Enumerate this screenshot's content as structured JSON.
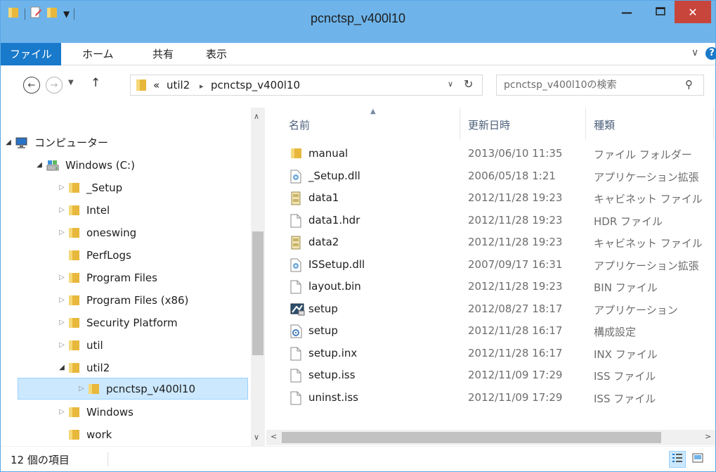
{
  "window": {
    "title": "pcnctsp_v400l10",
    "minimize_glyph": "—",
    "close_glyph": "✕"
  },
  "ribbon": {
    "tabs": [
      {
        "label": "ファイル"
      },
      {
        "label": "ホーム"
      },
      {
        "label": "共有"
      },
      {
        "label": "表示"
      }
    ],
    "expand_glyph": "∨",
    "help_glyph": "?"
  },
  "address": {
    "overflow": "«",
    "crumbs": [
      "util2",
      "pcnctsp_v400l10"
    ],
    "crumb_separator": "▸"
  },
  "search": {
    "placeholder": "pcnctsp_v400l10の検索"
  },
  "tree": [
    {
      "label": "コンピューター",
      "icon": "computer-icon",
      "expanded": true,
      "arrow": "◢"
    },
    {
      "label": "Windows (C:)",
      "icon": "drive-icon",
      "expanded": true,
      "arrow": "◢"
    },
    {
      "label": "_Setup",
      "icon": "folder-icon",
      "arrow": "▷"
    },
    {
      "label": "Intel",
      "icon": "folder-icon",
      "arrow": "▷"
    },
    {
      "label": "oneswing",
      "icon": "folder-icon",
      "arrow": "▷"
    },
    {
      "label": "PerfLogs",
      "icon": "folder-icon",
      "arrow": ""
    },
    {
      "label": "Program Files",
      "icon": "folder-icon",
      "arrow": "▷"
    },
    {
      "label": "Program Files (x86)",
      "icon": "folder-icon",
      "arrow": "▷"
    },
    {
      "label": "Security Platform",
      "icon": "folder-icon",
      "arrow": "▷"
    },
    {
      "label": "util",
      "icon": "folder-icon",
      "arrow": "▷"
    },
    {
      "label": "util2",
      "icon": "folder-icon",
      "expanded": true,
      "arrow": "◢"
    },
    {
      "label": "pcnctsp_v400l10",
      "icon": "folder-icon",
      "selected": true,
      "arrow": "▷"
    },
    {
      "label": "Windows",
      "icon": "folder-icon",
      "arrow": "▷"
    },
    {
      "label": "work",
      "icon": "folder-icon",
      "arrow": ""
    }
  ],
  "columns": {
    "name": "名前",
    "date": "更新日時",
    "type": "種類"
  },
  "files": [
    {
      "name": "manual",
      "date": "2013/06/10 11:35",
      "type": "ファイル フォルダー",
      "icon": "folder-icon"
    },
    {
      "name": "_Setup.dll",
      "date": "2006/05/18 1:21",
      "type": "アプリケーション拡張",
      "icon": "dll-icon"
    },
    {
      "name": "data1",
      "date": "2012/11/28 19:23",
      "type": "キャビネット ファイル",
      "icon": "cabinet-icon"
    },
    {
      "name": "data1.hdr",
      "date": "2012/11/28 19:23",
      "type": "HDR ファイル",
      "icon": "file-icon"
    },
    {
      "name": "data2",
      "date": "2012/11/28 19:23",
      "type": "キャビネット ファイル",
      "icon": "cabinet-icon"
    },
    {
      "name": "ISSetup.dll",
      "date": "2007/09/17 16:31",
      "type": "アプリケーション拡張",
      "icon": "dll-icon"
    },
    {
      "name": "layout.bin",
      "date": "2012/11/28 19:23",
      "type": "BIN ファイル",
      "icon": "file-icon"
    },
    {
      "name": "setup",
      "date": "2012/08/27 18:17",
      "type": "アプリケーション",
      "icon": "setup-exe-icon"
    },
    {
      "name": "setup",
      "date": "2012/11/28 16:17",
      "type": "構成設定",
      "icon": "config-icon"
    },
    {
      "name": "setup.inx",
      "date": "2012/11/28 16:17",
      "type": "INX ファイル",
      "icon": "file-icon"
    },
    {
      "name": "setup.iss",
      "date": "2012/11/09 17:29",
      "type": "ISS ファイル",
      "icon": "file-icon"
    },
    {
      "name": "uninst.iss",
      "date": "2012/11/09 17:29",
      "type": "ISS ファイル",
      "icon": "file-icon"
    }
  ],
  "status": {
    "item_count": "12 個の項目"
  },
  "colors": {
    "titlebar": "#6eb4ea",
    "file_tab": "#1979ca",
    "close_button": "#c7453b",
    "selection": "#cce8ff",
    "folder": "#e8b83c"
  }
}
